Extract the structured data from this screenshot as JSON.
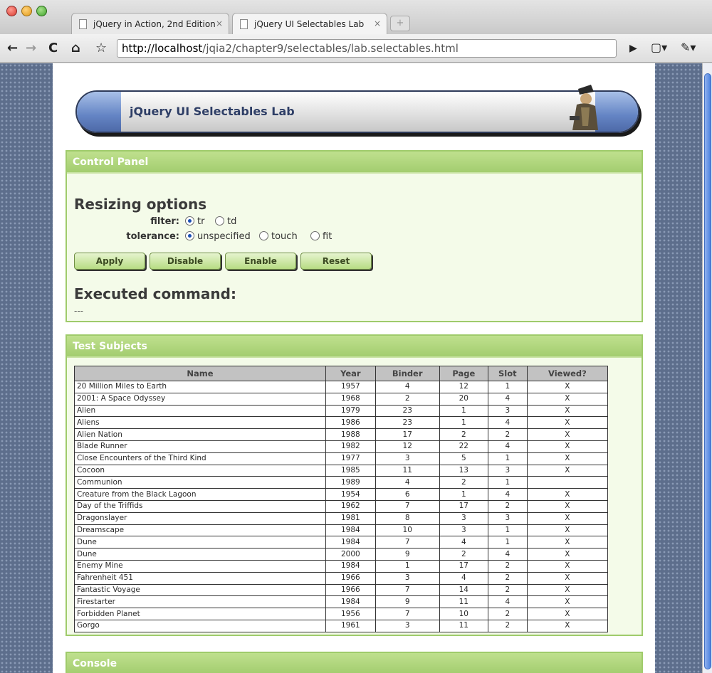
{
  "browser": {
    "tabs": [
      {
        "title": "jQuery in Action, 2nd Edition",
        "close": "×"
      },
      {
        "title": "jQuery UI Selectables Lab",
        "close": "×"
      }
    ],
    "nav": {
      "back": "←",
      "forward": "→",
      "reload": "C",
      "home": "⌂",
      "star": "☆",
      "go": "▶",
      "page": "▢▾",
      "wrench": "✎▾"
    },
    "url": {
      "host": "http://localhost",
      "path": "/jqia2/chapter9/selectables/lab.selectables.html"
    }
  },
  "banner": {
    "title": "jQuery UI Selectables Lab"
  },
  "control_panel": {
    "heading": "Control Panel",
    "section_title": "Resizing options",
    "filter": {
      "label": "filter:",
      "options": [
        "tr",
        "td"
      ],
      "selected": "tr"
    },
    "tolerance": {
      "label": "tolerance:",
      "options": [
        "unspecified",
        "touch",
        "fit"
      ],
      "selected": "unspecified"
    },
    "buttons": {
      "apply": "Apply",
      "disable": "Disable",
      "enable": "Enable",
      "reset": "Reset"
    },
    "executed_title": "Executed command:",
    "executed_value": "---"
  },
  "test_subjects": {
    "heading": "Test Subjects",
    "columns": [
      "Name",
      "Year",
      "Binder",
      "Page",
      "Slot",
      "Viewed?"
    ],
    "rows": [
      [
        "20 Million Miles to Earth",
        "1957",
        "4",
        "12",
        "1",
        "X"
      ],
      [
        "2001: A Space Odyssey",
        "1968",
        "2",
        "20",
        "4",
        "X"
      ],
      [
        "Alien",
        "1979",
        "23",
        "1",
        "3",
        "X"
      ],
      [
        "Aliens",
        "1986",
        "23",
        "1",
        "4",
        "X"
      ],
      [
        "Alien Nation",
        "1988",
        "17",
        "2",
        "2",
        "X"
      ],
      [
        "Blade Runner",
        "1982",
        "12",
        "22",
        "4",
        "X"
      ],
      [
        "Close Encounters of the Third Kind",
        "1977",
        "3",
        "5",
        "1",
        "X"
      ],
      [
        "Cocoon",
        "1985",
        "11",
        "13",
        "3",
        "X"
      ],
      [
        "Communion",
        "1989",
        "4",
        "2",
        "1",
        ""
      ],
      [
        "Creature from the Black Lagoon",
        "1954",
        "6",
        "1",
        "4",
        "X"
      ],
      [
        "Day of the Triffids",
        "1962",
        "7",
        "17",
        "2",
        "X"
      ],
      [
        "Dragonslayer",
        "1981",
        "8",
        "3",
        "3",
        "X"
      ],
      [
        "Dreamscape",
        "1984",
        "10",
        "3",
        "1",
        "X"
      ],
      [
        "Dune",
        "1984",
        "7",
        "4",
        "1",
        "X"
      ],
      [
        "Dune",
        "2000",
        "9",
        "2",
        "4",
        "X"
      ],
      [
        "Enemy Mine",
        "1984",
        "1",
        "17",
        "2",
        "X"
      ],
      [
        "Fahrenheit 451",
        "1966",
        "3",
        "4",
        "2",
        "X"
      ],
      [
        "Fantastic Voyage",
        "1966",
        "7",
        "14",
        "2",
        "X"
      ],
      [
        "Firestarter",
        "1984",
        "9",
        "11",
        "4",
        "X"
      ],
      [
        "Forbidden Planet",
        "1956",
        "7",
        "10",
        "2",
        "X"
      ],
      [
        "Gorgo",
        "1961",
        "3",
        "11",
        "2",
        "X"
      ]
    ]
  },
  "console": {
    "heading": "Console"
  },
  "colors": {
    "panel_head": "#a3cd6f",
    "panel_bg": "#f4fbe9",
    "banner_cap": "#6484c4",
    "page_bg_pattern": "#5d6e8c"
  }
}
